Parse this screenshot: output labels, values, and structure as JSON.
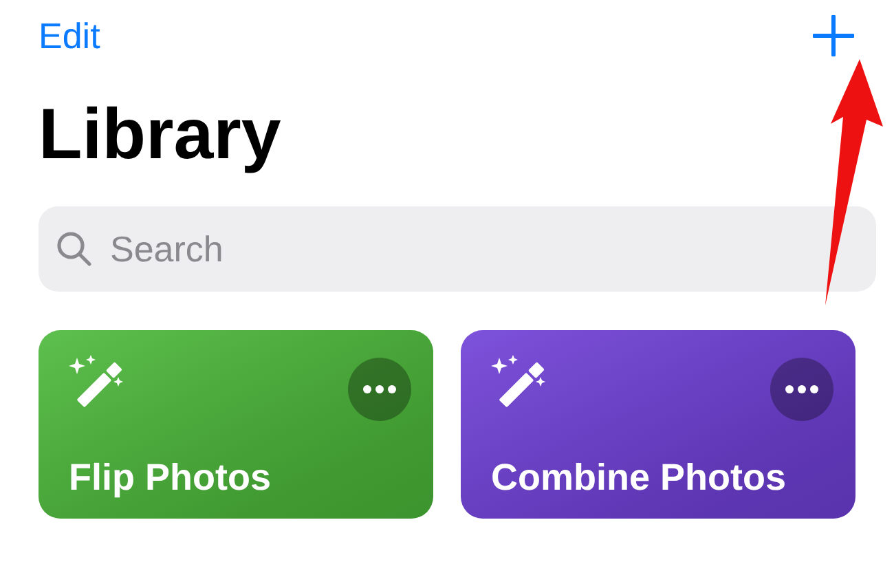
{
  "nav": {
    "edit": "Edit"
  },
  "title": "Library",
  "search": {
    "placeholder": "Search"
  },
  "shortcuts": [
    {
      "name": "Flip Photos",
      "color": "#4cb93a"
    },
    {
      "name": "Combine Photos",
      "color": "#7040d8"
    }
  ]
}
